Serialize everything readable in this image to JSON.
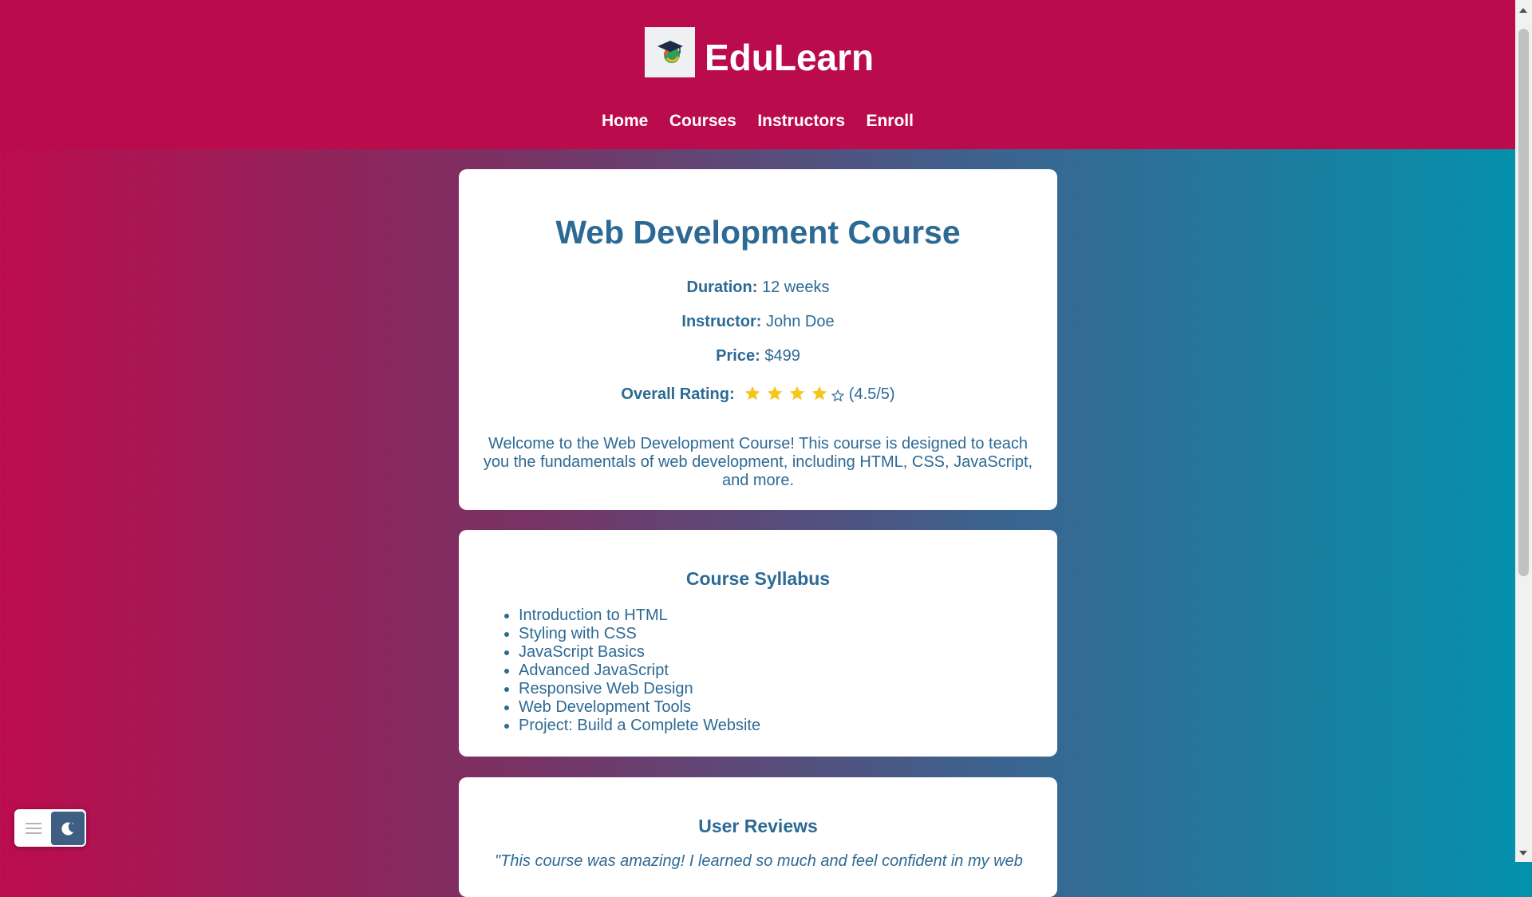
{
  "brand": {
    "name": "EduLearn",
    "logo_icon": "graduation-cap-icon"
  },
  "nav": [
    {
      "label": "Home"
    },
    {
      "label": "Courses"
    },
    {
      "label": "Instructors"
    },
    {
      "label": "Enroll"
    }
  ],
  "course": {
    "title": "Web Development Course",
    "duration_label": "Duration:",
    "duration": "12 weeks",
    "instructor_label": "Instructor:",
    "instructor": "John Doe",
    "price_label": "Price:",
    "price": "$499",
    "rating_label": "Overall Rating:",
    "rating_value": 4.5,
    "rating_max": 5,
    "rating_text": "(4.5/5)",
    "description": "Welcome to the Web Development Course! This course is designed to teach you the fundamentals of web development, including HTML, CSS, JavaScript, and more."
  },
  "syllabus": {
    "title": "Course Syllabus",
    "items": [
      "Introduction to HTML",
      "Styling with CSS",
      "JavaScript Basics",
      "Advanced JavaScript",
      "Responsive Web Design",
      "Web Development Tools",
      "Project: Build a Complete Website"
    ]
  },
  "reviews": {
    "title": "User Reviews",
    "first_quote": "\"This course was amazing! I learned so much and feel confident in my web"
  },
  "colors": {
    "header": "#ba0b4c",
    "accent_text": "#2c6a95",
    "star": "#f5c518"
  }
}
